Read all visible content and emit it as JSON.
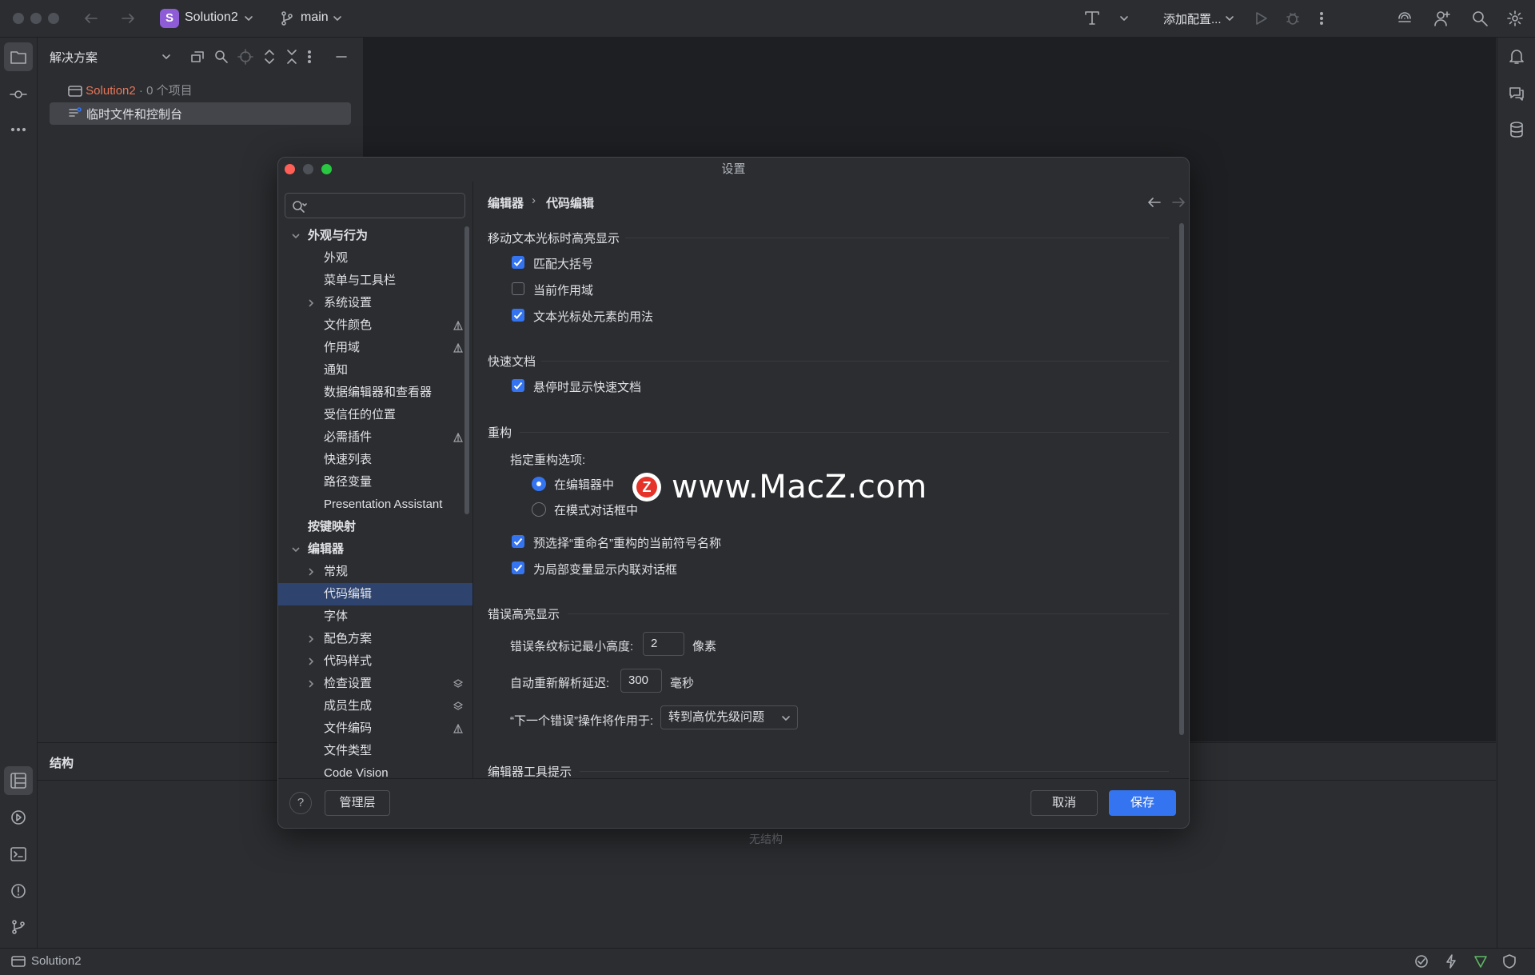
{
  "titlebar": {
    "project_badge": "S",
    "project_name": "Solution2",
    "branch": "main",
    "run_config": "添加配置..."
  },
  "project_panel": {
    "title": "解决方案",
    "solution_name": "Solution2",
    "solution_meta": " · 0 个项目",
    "scratch_label": "临时文件和控制台"
  },
  "structure_panel": {
    "title": "结构",
    "empty_text": "无结构"
  },
  "statusbar": {
    "project": "Solution2"
  },
  "settings": {
    "title": "设置",
    "search_placeholder": "",
    "nav": [
      {
        "label": "外观与行为",
        "level": 0,
        "expanded": true,
        "bold": true
      },
      {
        "label": "外观",
        "level": 1
      },
      {
        "label": "菜单与工具栏",
        "level": 1
      },
      {
        "label": "系统设置",
        "level": 1,
        "collapsed": true
      },
      {
        "label": "文件颜色",
        "level": 1,
        "mark": "project"
      },
      {
        "label": "作用域",
        "level": 1,
        "mark": "project"
      },
      {
        "label": "通知",
        "level": 1
      },
      {
        "label": "数据编辑器和查看器",
        "level": 1
      },
      {
        "label": "受信任的位置",
        "level": 1
      },
      {
        "label": "必需插件",
        "level": 1,
        "mark": "project"
      },
      {
        "label": "快速列表",
        "level": 1
      },
      {
        "label": "路径变量",
        "level": 1
      },
      {
        "label": "Presentation Assistant",
        "level": 1
      },
      {
        "label": "按键映射",
        "level": 0,
        "bold": true
      },
      {
        "label": "编辑器",
        "level": 0,
        "expanded": true,
        "bold": true
      },
      {
        "label": "常规",
        "level": 1,
        "collapsed": true
      },
      {
        "label": "代码编辑",
        "level": 1,
        "selected": true
      },
      {
        "label": "字体",
        "level": 1
      },
      {
        "label": "配色方案",
        "level": 1,
        "collapsed": true
      },
      {
        "label": "代码样式",
        "level": 1,
        "collapsed": true
      },
      {
        "label": "检查设置",
        "level": 1,
        "collapsed": true,
        "mark": "layers"
      },
      {
        "label": "成员生成",
        "level": 1,
        "mark": "layers"
      },
      {
        "label": "文件编码",
        "level": 1,
        "mark": "project"
      },
      {
        "label": "文件类型",
        "level": 1
      },
      {
        "label": "Code Vision",
        "level": 1
      }
    ],
    "breadcrumb": {
      "parent": "编辑器",
      "sep": "›",
      "current": "代码编辑"
    },
    "sections": {
      "caret": {
        "title": "移动文本光标时高亮显示",
        "items": [
          {
            "label": "匹配大括号",
            "checked": true
          },
          {
            "label": "当前作用域",
            "checked": false
          },
          {
            "label": "文本光标处元素的用法",
            "checked": true
          }
        ]
      },
      "quickdoc": {
        "title": "快速文档",
        "items": [
          {
            "label": "悬停时显示快速文档",
            "checked": true
          }
        ]
      },
      "refactor": {
        "title": "重构",
        "option_label": "指定重构选项:",
        "radio_editor": "在编辑器中",
        "radio_modal": "在模式对话框中",
        "items": [
          {
            "label": "预选择“重命名”重构的当前符号名称",
            "checked": true
          },
          {
            "label": "为局部变量显示内联对话框",
            "checked": true
          }
        ]
      },
      "errors": {
        "title": "错误高亮显示",
        "stripe_label": "错误条纹标记最小高度:",
        "stripe_value": "2",
        "stripe_unit": "像素",
        "reparse_label": "自动重新解析延迟:",
        "reparse_value": "300",
        "reparse_unit": "毫秒",
        "next_error_label": "“下一个错误”操作将作用于:",
        "next_error_value": "转到高优先级问题"
      },
      "tooltips": {
        "title": "编辑器工具提示"
      }
    },
    "footer": {
      "help": "?",
      "manage": "管理层",
      "cancel": "取消",
      "save": "保存"
    }
  },
  "watermark": {
    "logo_letter": "Z",
    "text": "www.MacZ.com"
  },
  "colors": {
    "accent": "#3574f0",
    "selection": "#2e436e",
    "background": "#2b2d30",
    "solution_name": "#e8775a"
  }
}
